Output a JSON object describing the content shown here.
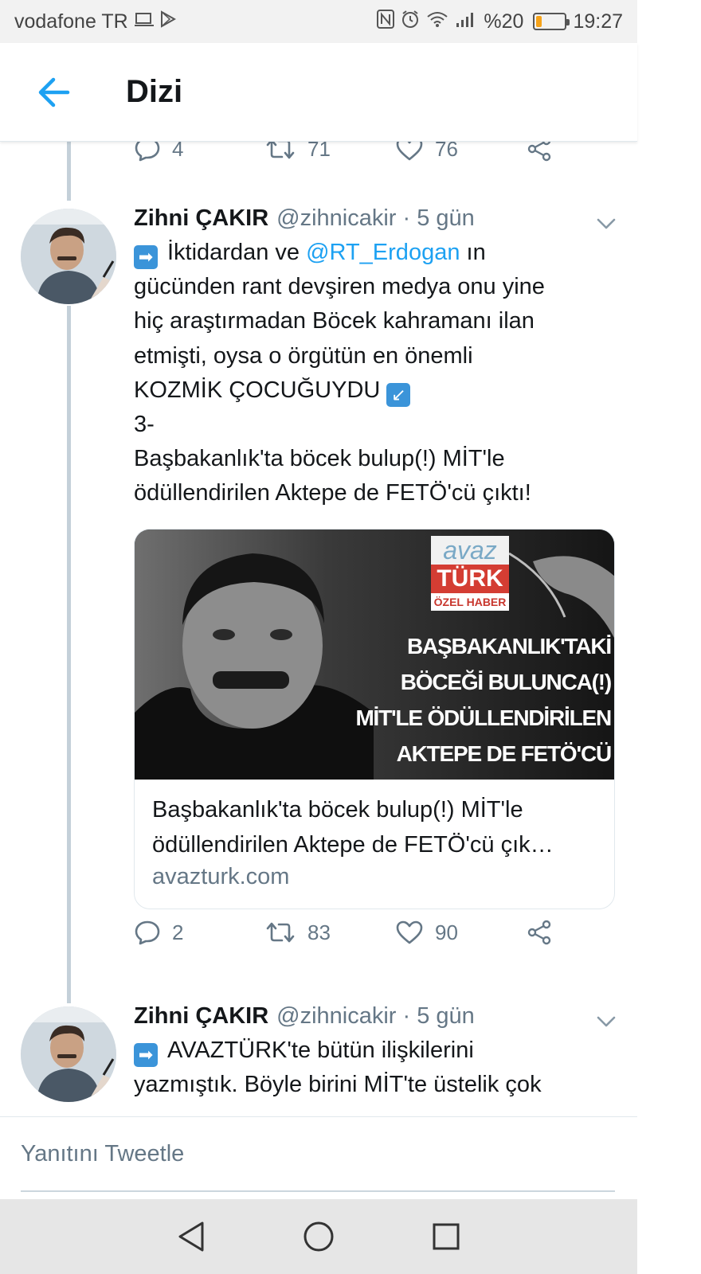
{
  "status_bar": {
    "carrier": "vodafone TR",
    "battery": "%20",
    "battery_level": 0.2,
    "time": "19:27",
    "icons": [
      "screen-cast-icon",
      "play-store-icon",
      "nfc-icon",
      "alarm-icon",
      "wifi-icon",
      "signal-icon",
      "battery-icon"
    ]
  },
  "header": {
    "title": "Dizi",
    "back_icon": "arrow-left-icon"
  },
  "colors": {
    "accent": "#1da1f2",
    "text": "#14171a",
    "muted": "#657786",
    "thread_line": "#c4d0d9",
    "battery": "#f6a31a"
  },
  "top_actions": {
    "reply_count": "4",
    "retweet_count": "71",
    "like_count": "76"
  },
  "tweets": [
    {
      "name": "Zihni ÇAKIR",
      "handle": "@zihnicakir · 5 gün",
      "text_before_mention": "İktidardan ve ",
      "mention": "@RT_Erdogan",
      "text_after_mention": " ın\ngücünden rant devşiren medya onu yine\nhiç araştırmadan Böcek kahramanı ilan\netmişti, oysa o örgütün en önemli\nKOZMİK ÇOCUĞUYDU ",
      "text_tail": "\n3-\nBaşbakanlık'ta böcek bulup(!) MİT'le\nödüllendirilen Aktepe de FETÖ'cü çıktı!",
      "card": {
        "image_brand_top": "avaz",
        "image_brand_bottom": "TÜRK",
        "image_tag": "ÖZEL HABER",
        "image_headline": [
          "BAŞBAKANLIK'TAKİ",
          "BÖCEĞİ BULUNCA(!)",
          "MİT'LE ÖDÜLLENDİRİLEN",
          "AKTEPE DE FETÖ'CÜ ÇIKTI.."
        ],
        "title": "Başbakanlık'ta böcek bulup(!) MİT'le ödüllendirilen Aktepe de FETÖ'cü çık…",
        "domain": "avazturk.com"
      },
      "reply_count": "2",
      "retweet_count": "83",
      "like_count": "90"
    },
    {
      "name": "Zihni ÇAKIR",
      "handle": "@zihnicakir · 5 gün",
      "text": "AVAZTÜRK'te bütün ilişkilerini\nyazmıştık. Böyle birini MİT'te üstelik çok"
    }
  ],
  "reply_bar": {
    "placeholder": "Yanıtını Tweetle"
  },
  "nav_bar": {
    "icons": [
      "back-triangle-icon",
      "home-circle-icon",
      "recents-square-icon"
    ]
  }
}
